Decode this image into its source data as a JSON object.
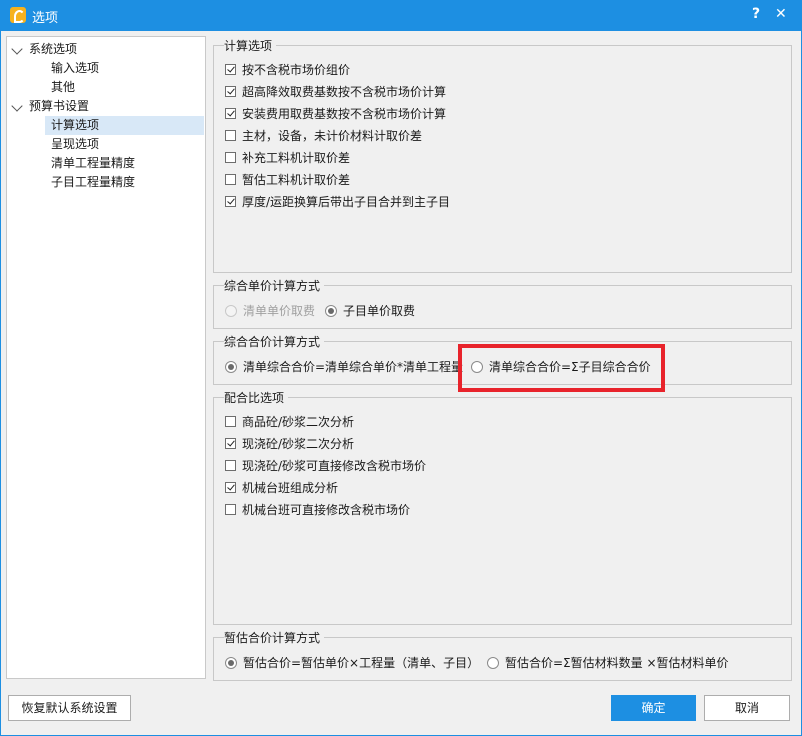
{
  "window": {
    "title": "选项",
    "help_label": "?",
    "close_label": "✕"
  },
  "tree": {
    "nodes": [
      {
        "label": "系统选项"
      },
      {
        "label": "输入选项"
      },
      {
        "label": "其他"
      },
      {
        "label": "预算书设置"
      },
      {
        "label": "计算选项"
      },
      {
        "label": "呈现选项"
      },
      {
        "label": "清单工程量精度"
      },
      {
        "label": "子目工程量精度"
      }
    ],
    "selected": "计算选项"
  },
  "calc_options": {
    "title": "计算选项",
    "items": [
      {
        "label": "按不含税市场价组价",
        "checked": true
      },
      {
        "label": "超高降效取费基数按不含税市场价计算",
        "checked": true
      },
      {
        "label": "安装费用取费基数按不含税市场价计算",
        "checked": true
      },
      {
        "label": "主材，设备，未计价材料计取价差",
        "checked": false
      },
      {
        "label": "补充工料机计取价差",
        "checked": false
      },
      {
        "label": "暂估工料机计取价差",
        "checked": false
      },
      {
        "label": "厚度/运距换算后带出子目合并到主子目",
        "checked": true
      }
    ]
  },
  "unit_price_method": {
    "title": "综合单价计算方式",
    "options": [
      {
        "label": "清单单价取费",
        "selected": false,
        "disabled": true
      },
      {
        "label": "子目单价取费",
        "selected": true,
        "disabled": false
      }
    ]
  },
  "total_price_method": {
    "title": "综合合价计算方式",
    "options": [
      {
        "label": "清单综合合价=清单综合单价*清单工程量",
        "selected": true
      },
      {
        "label": "清单综合合价=Σ子目综合合价",
        "selected": false
      }
    ]
  },
  "mix_options": {
    "title": "配合比选项",
    "items": [
      {
        "label": "商品砼/砂浆二次分析",
        "checked": false
      },
      {
        "label": "现浇砼/砂浆二次分析",
        "checked": true
      },
      {
        "label": "现浇砼/砂浆可直接修改含税市场价",
        "checked": false
      },
      {
        "label": "机械台班组成分析",
        "checked": true
      },
      {
        "label": "机械台班可直接修改含税市场价",
        "checked": false
      }
    ]
  },
  "estimate_method": {
    "title": "暂估合价计算方式",
    "options": [
      {
        "label": "暂估合价=暂估单价×工程量（清单、子目）",
        "selected": true
      },
      {
        "label": "暂估合价=Σ暂估材料数量 ×暂估材料单价",
        "selected": false
      }
    ]
  },
  "buttons": {
    "restore": "恢复默认系统设置",
    "ok": "确定",
    "cancel": "取消"
  },
  "colors": {
    "title_bar": "#1d8fe2",
    "primary_button": "#1d8fe2",
    "highlight": "#e8232b"
  }
}
